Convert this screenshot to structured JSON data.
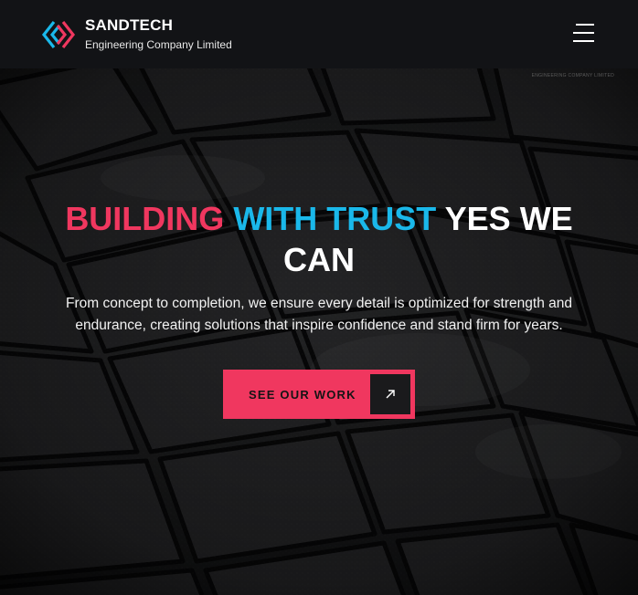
{
  "header": {
    "brand_name": "SANDTECH",
    "brand_subtitle": "Engineering Company Limited",
    "logo_icon": "hexagon-chevron-logo-icon",
    "menu_icon": "hamburger-menu-icon",
    "colors": {
      "background": "#121316",
      "logo_pink": "#f0375f",
      "logo_blue": "#1ab8ea"
    }
  },
  "hero": {
    "tag_text": "ENGINEERING COMPANY LIMITED",
    "headline": {
      "part_pink": "BUILDING",
      "part_blue": "WITH TRUST",
      "part_white": "YES WE CAN"
    },
    "description": "From concept to completion, we ensure every detail is optimized for strength and endurance, creating solutions that inspire confidence and stand firm for years.",
    "cta": {
      "label": "SEE OUR WORK",
      "icon": "arrow-up-right-icon"
    },
    "background_image": "dark-stone-pavement-photo",
    "colors": {
      "accent_pink": "#f0375f",
      "accent_blue": "#1ab8ea",
      "cta_icon_bg": "#1a1a1c"
    }
  }
}
